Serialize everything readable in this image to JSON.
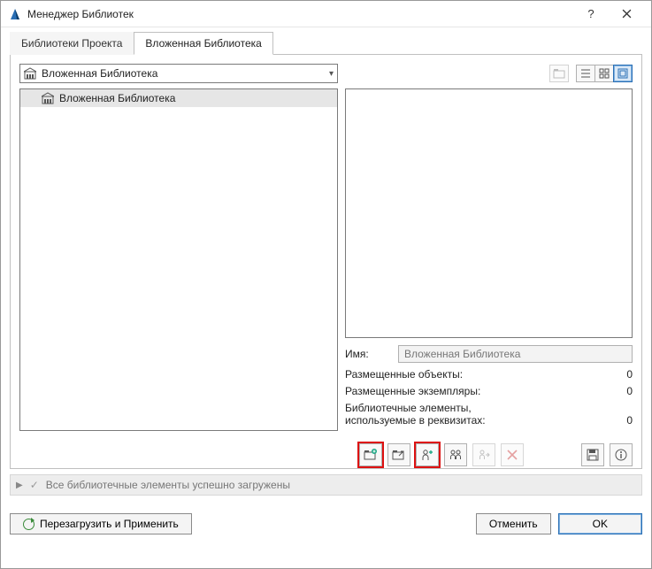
{
  "window": {
    "title": "Менеджер Библиотек"
  },
  "tabs": {
    "project": "Библиотеки Проекта",
    "embedded": "Вложенная Библиотека"
  },
  "combo": {
    "selected": "Вложенная Библиотека"
  },
  "tree": {
    "item0": "Вложенная Библиотека"
  },
  "info": {
    "name_label": "Имя:",
    "name_value": "Вложенная Библиотека",
    "placed_objects_label": "Размещенные объекты:",
    "placed_objects_value": "0",
    "placed_instances_label": "Размещенные экземпляры:",
    "placed_instances_value": "0",
    "attrs_label_line1": "Библиотечные элементы,",
    "attrs_label_line2": "используемые в реквизитах:",
    "attrs_value": "0"
  },
  "status": {
    "message": "Все библиотечные элементы успешно загружены"
  },
  "buttons": {
    "reload": "Перезагрузить и Применить",
    "cancel": "Отменить",
    "ok": "OK"
  }
}
